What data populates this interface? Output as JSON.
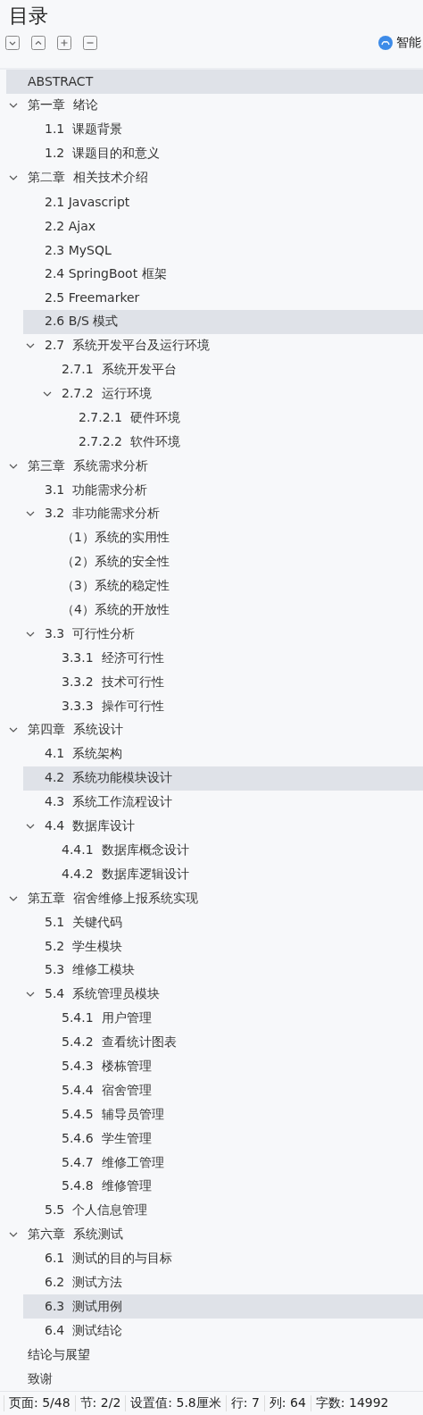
{
  "panel": {
    "title": "目录",
    "toolbar": [
      {
        "kind": "expand-down"
      },
      {
        "kind": "collapse-up"
      },
      {
        "kind": "plus"
      },
      {
        "kind": "minus"
      }
    ],
    "assistant_label": "智能"
  },
  "toc": [
    {
      "label": "ABSTRACT",
      "selected": true
    },
    {
      "label": "第一章  绪论",
      "selected": false,
      "expanded": true,
      "children": [
        {
          "label": "1.1  课题背景",
          "selected": false
        },
        {
          "label": "1.2  课题目的和意义",
          "selected": false
        }
      ]
    },
    {
      "label": "第二章  相关技术介绍",
      "selected": false,
      "expanded": true,
      "children": [
        {
          "label": "2.1 Javascript",
          "selected": false
        },
        {
          "label": "2.2 Ajax",
          "selected": false
        },
        {
          "label": "2.3 MySQL",
          "selected": false
        },
        {
          "label": "2.4 SpringBoot 框架",
          "selected": false
        },
        {
          "label": "2.5 Freemarker",
          "selected": false
        },
        {
          "label": "2.6 B/S 模式",
          "selected": true
        },
        {
          "label": "2.7  系统开发平台及运行环境",
          "selected": false,
          "expanded": true,
          "children": [
            {
              "label": "2.7.1  系统开发平台",
              "selected": false
            },
            {
              "label": "2.7.2  运行环境",
              "selected": false,
              "expanded": true,
              "children": [
                {
                  "label": "2.7.2.1  硬件环境",
                  "selected": false
                },
                {
                  "label": "2.7.2.2  软件环境",
                  "selected": false
                }
              ]
            }
          ]
        }
      ]
    },
    {
      "label": "第三章  系统需求分析",
      "selected": false,
      "expanded": true,
      "children": [
        {
          "label": "3.1  功能需求分析",
          "selected": false
        },
        {
          "label": "3.2  非功能需求分析",
          "selected": false,
          "expanded": true,
          "children": [
            {
              "label": "（1）系统的实用性",
              "selected": false
            },
            {
              "label": "（2）系统的安全性",
              "selected": false
            },
            {
              "label": "（3）系统的稳定性",
              "selected": false
            },
            {
              "label": "（4）系统的开放性",
              "selected": false
            }
          ]
        },
        {
          "label": "3.3  可行性分析",
          "selected": false,
          "expanded": true,
          "children": [
            {
              "label": "3.3.1  经济可行性",
              "selected": false
            },
            {
              "label": "3.3.2  技术可行性",
              "selected": false
            },
            {
              "label": "3.3.3  操作可行性",
              "selected": false
            }
          ]
        }
      ]
    },
    {
      "label": "第四章  系统设计",
      "selected": false,
      "expanded": true,
      "children": [
        {
          "label": "4.1  系统架构",
          "selected": false
        },
        {
          "label": "4.2  系统功能模块设计",
          "selected": true
        },
        {
          "label": "4.3  系统工作流程设计",
          "selected": false
        },
        {
          "label": "4.4  数据库设计",
          "selected": false,
          "expanded": true,
          "children": [
            {
              "label": "4.4.1  数据库概念设计",
              "selected": false
            },
            {
              "label": "4.4.2  数据库逻辑设计",
              "selected": false
            }
          ]
        }
      ]
    },
    {
      "label": "第五章  宿舍维修上报系统实现",
      "selected": false,
      "expanded": true,
      "children": [
        {
          "label": "5.1  关键代码",
          "selected": false
        },
        {
          "label": "5.2  学生模块",
          "selected": false
        },
        {
          "label": "5.3  维修工模块",
          "selected": false
        },
        {
          "label": "5.4  系统管理员模块",
          "selected": false,
          "expanded": true,
          "children": [
            {
              "label": "5.4.1  用户管理",
              "selected": false
            },
            {
              "label": "5.4.2  查看统计图表",
              "selected": false
            },
            {
              "label": "5.4.3  楼栋管理",
              "selected": false
            },
            {
              "label": "5.4.4  宿舍管理",
              "selected": false
            },
            {
              "label": "5.4.5  辅导员管理",
              "selected": false
            },
            {
              "label": "5.4.6  学生管理",
              "selected": false
            },
            {
              "label": "5.4.7  维修工管理",
              "selected": false
            },
            {
              "label": "5.4.8  维修管理",
              "selected": false
            }
          ]
        },
        {
          "label": "5.5  个人信息管理",
          "selected": false
        }
      ]
    },
    {
      "label": "第六章  系统测试",
      "selected": false,
      "expanded": true,
      "children": [
        {
          "label": "6.1  测试的目的与目标",
          "selected": false
        },
        {
          "label": "6.2  测试方法",
          "selected": false
        },
        {
          "label": "6.3  测试用例",
          "selected": true
        },
        {
          "label": "6.4  测试结论",
          "selected": false
        }
      ]
    },
    {
      "label": "结论与展望",
      "selected": false
    },
    {
      "label": "致谢",
      "selected": false
    }
  ],
  "status_bar": [
    "页面: 5/48",
    "节: 2/2",
    "设置值: 5.8厘米",
    "行: 7",
    "列: 64",
    "字数: 14992"
  ]
}
